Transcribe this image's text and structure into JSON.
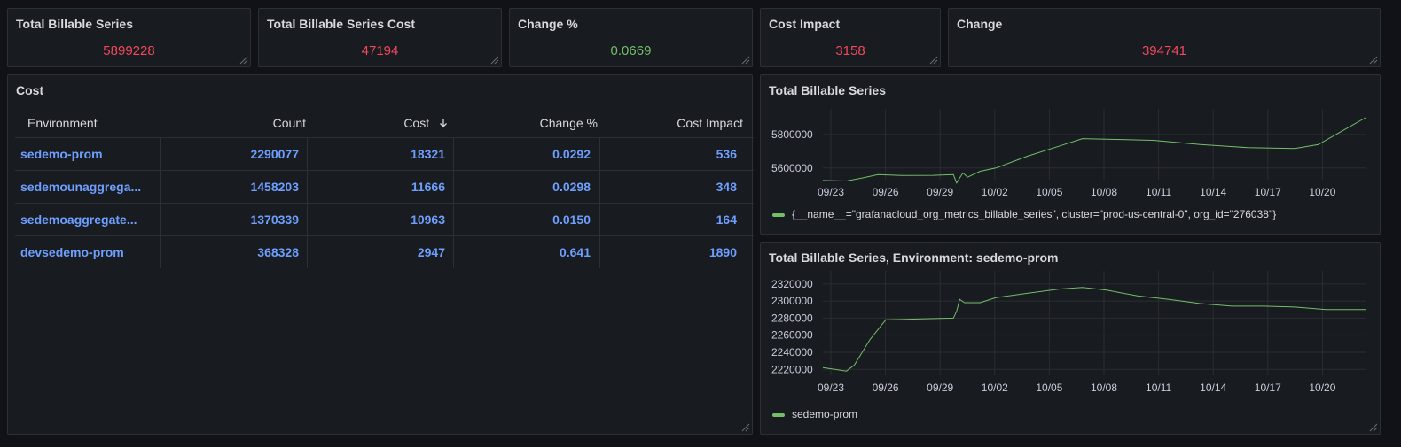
{
  "colors": {
    "red": "#f2495c",
    "green": "#73bf69",
    "blue": "#6e9fff",
    "series": "#73bf69"
  },
  "stats": [
    {
      "title": "Total Billable Series",
      "value": "5899228",
      "color": "red"
    },
    {
      "title": "Total Billable Series Cost",
      "value": "47194",
      "color": "red"
    },
    {
      "title": "Change %",
      "value": "0.0669",
      "color": "green"
    },
    {
      "title": "Cost Impact",
      "value": "3158",
      "color": "red"
    },
    {
      "title": "Change",
      "value": "394741",
      "color": "red"
    }
  ],
  "cost_panel": {
    "title": "Cost",
    "headers": [
      "Environment",
      "Count",
      "Cost",
      "Change %",
      "Cost Impact"
    ],
    "sort_icon": "arrow-down-icon",
    "rows": [
      [
        "sedemo-prom",
        "2290077",
        "18321",
        "0.0292",
        "536"
      ],
      [
        "sedemounaggrega...",
        "1458203",
        "11666",
        "0.0298",
        "348"
      ],
      [
        "sedemoaggregate...",
        "1370339",
        "10963",
        "0.0150",
        "164"
      ],
      [
        "devsedemo-prom",
        "368328",
        "2947",
        "0.641",
        "1890"
      ]
    ]
  },
  "chart_data": [
    {
      "type": "line",
      "title": "Total Billable Series",
      "x_ticks": [
        "09/23",
        "09/26",
        "09/29",
        "10/02",
        "10/05",
        "10/08",
        "10/11",
        "10/14",
        "10/17",
        "10/20"
      ],
      "y_ticks": [
        "5600000",
        "5800000"
      ],
      "ylim": [
        5530000,
        5900000
      ],
      "series": [
        {
          "name": "{__name__=\"grafanacloud_org_metrics_billable_series\", cluster=\"prod-us-central-0\", org_id=\"276038\"}",
          "points": [
            [
              0,
              5525000
            ],
            [
              1.5,
              5522000
            ],
            [
              2.5,
              5540000
            ],
            [
              3.5,
              5560000
            ],
            [
              5,
              5555000
            ],
            [
              7,
              5556000
            ],
            [
              8.3,
              5560000
            ],
            [
              8.5,
              5510000
            ],
            [
              8.9,
              5570000
            ],
            [
              9.2,
              5545000
            ],
            [
              10,
              5580000
            ],
            [
              11,
              5600000
            ],
            [
              13,
              5670000
            ],
            [
              15,
              5730000
            ],
            [
              16.5,
              5775000
            ],
            [
              18,
              5772000
            ],
            [
              21,
              5765000
            ],
            [
              24,
              5740000
            ],
            [
              27,
              5722000
            ],
            [
              30,
              5716000
            ],
            [
              31.5,
              5740000
            ],
            [
              33,
              5820000
            ],
            [
              34.5,
              5900000
            ]
          ]
        }
      ]
    },
    {
      "type": "line",
      "title": "Total Billable Series, Environment: sedemo-prom",
      "x_ticks": [
        "09/23",
        "09/26",
        "09/29",
        "10/02",
        "10/05",
        "10/08",
        "10/11",
        "10/14",
        "10/17",
        "10/20"
      ],
      "y_ticks": [
        "2220000",
        "2240000",
        "2260000",
        "2280000",
        "2300000",
        "2320000"
      ],
      "ylim": [
        2213000,
        2325000
      ],
      "series": [
        {
          "name": "sedemo-prom",
          "points": [
            [
              0,
              2222000
            ],
            [
              1.5,
              2218000
            ],
            [
              2,
              2225000
            ],
            [
              3,
              2255000
            ],
            [
              4,
              2278000
            ],
            [
              6,
              2279000
            ],
            [
              8.3,
              2280000
            ],
            [
              8.5,
              2288000
            ],
            [
              8.7,
              2302000
            ],
            [
              9,
              2298000
            ],
            [
              10,
              2298000
            ],
            [
              11,
              2304000
            ],
            [
              13,
              2309000
            ],
            [
              15,
              2314000
            ],
            [
              16.5,
              2316000
            ],
            [
              18,
              2313000
            ],
            [
              20,
              2306000
            ],
            [
              22,
              2302000
            ],
            [
              24,
              2297000
            ],
            [
              26,
              2294000
            ],
            [
              28,
              2294000
            ],
            [
              30,
              2293000
            ],
            [
              32,
              2290000
            ],
            [
              34.5,
              2290000
            ]
          ]
        }
      ]
    }
  ]
}
